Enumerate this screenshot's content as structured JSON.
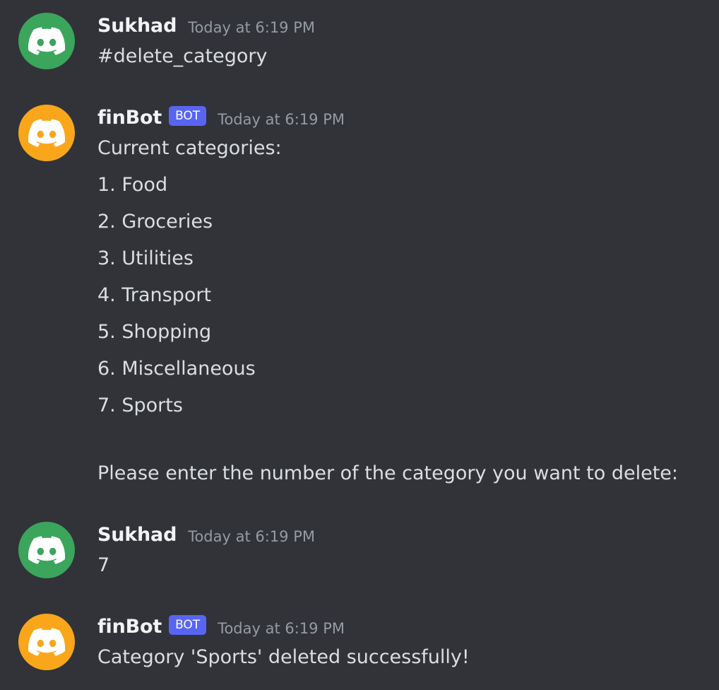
{
  "colors": {
    "background": "#313338",
    "username": "#f2f3f5",
    "message_text": "#dbdee1",
    "timestamp": "#949ba4",
    "bot_tag": "#5865f2",
    "avatar_green": "#3ba55c",
    "avatar_orange": "#faa61a"
  },
  "messages": [
    {
      "author": "Sukhad",
      "avatar_icon": "discord-logo-icon",
      "timestamp": "Today at 6:19 PM",
      "lines": [
        "#delete_category"
      ]
    },
    {
      "author": "finBot",
      "bot_tag": "BOT",
      "avatar_icon": "discord-logo-icon",
      "timestamp": "Today at 6:19 PM",
      "lines": [
        "Current categories:",
        "1. Food",
        "2. Groceries",
        "3. Utilities",
        "4. Transport",
        "5. Shopping",
        "6. Miscellaneous",
        "7. Sports",
        "Please enter the number of the category you want to delete:"
      ]
    },
    {
      "author": "Sukhad",
      "avatar_icon": "discord-logo-icon",
      "timestamp": "Today at 6:19 PM",
      "lines": [
        "7"
      ]
    },
    {
      "author": "finBot",
      "bot_tag": "BOT",
      "avatar_icon": "discord-logo-icon",
      "timestamp": "Today at 6:19 PM",
      "lines": [
        "Category 'Sports' deleted successfully!"
      ]
    }
  ]
}
